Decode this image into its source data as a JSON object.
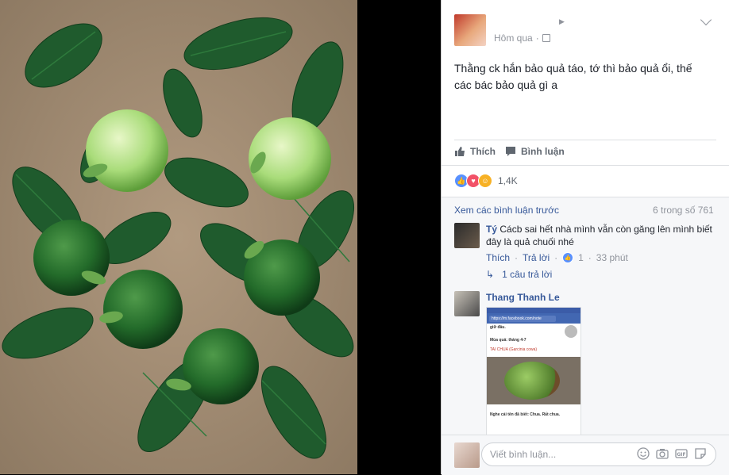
{
  "post": {
    "timestamp": "Hôm qua",
    "text": "Thằng ck hắn bảo quả táo, tớ thì bảo quả ổi, thế các bác bảo quả gì a"
  },
  "actions": {
    "like_label": "Thích",
    "comment_label": "Bình luận"
  },
  "reactions": {
    "count": "1,4K"
  },
  "comments": {
    "view_previous": "Xem các bình luận trước",
    "counter": "6 trong số 761",
    "items": [
      {
        "author": "Tý",
        "text": "Cácb sai hết nhà mình vẫn còn găng lên mình biết đây là quả chuối nhé",
        "like_label": "Thích",
        "reply_label": "Trả lời",
        "likes": "1",
        "time": "33 phút",
        "replies_label": "1 câu trả lời"
      },
      {
        "author": "Thang Thanh Le",
        "screenshot": {
          "url": "https://m.facebook.com/note",
          "line_top": "giữ đâu.",
          "season": "Mùa quả: tháng 4-7",
          "fruit_name": "TAI CHUA (Garcinia cowa)",
          "caption": "Nghe cái tên đã biết: Chua. Rất chua."
        }
      }
    ]
  },
  "composer": {
    "placeholder": "Viết bình luận..."
  },
  "colors": {
    "fb_blue": "#365899",
    "like_blue": "#5890ff",
    "love_red": "#f25268",
    "haha_yellow": "#f7b125"
  }
}
